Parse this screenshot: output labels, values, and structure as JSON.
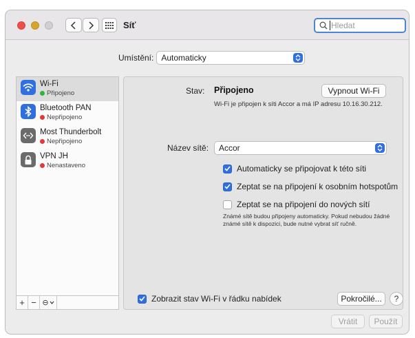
{
  "window": {
    "title": "Síť"
  },
  "search": {
    "placeholder": "Hledat"
  },
  "location": {
    "label": "Umístění:",
    "value": "Automaticky"
  },
  "services": [
    {
      "name": "Wi-Fi",
      "status": "Připojeno",
      "status_color": "#2fb53a",
      "icon": "wifi-icon"
    },
    {
      "name": "Bluetooth PAN",
      "status": "Nepřipojeno",
      "status_color": "#e03a3a",
      "icon": "bluetooth-icon"
    },
    {
      "name": "Most Thunderbolt",
      "status": "Nepřipojeno",
      "status_color": "#e03a3a",
      "icon": "thunderbolt-bridge-icon"
    },
    {
      "name": "VPN JH",
      "status": "Nenastaveno",
      "status_color": "#e03a3a",
      "icon": "vpn-lock-icon"
    }
  ],
  "sidebar_tools": {
    "add": "+",
    "remove": "−",
    "action": "⊖"
  },
  "detail": {
    "status_label": "Stav:",
    "status_value": "Připojeno",
    "turn_off_button": "Vypnout Wi-Fi",
    "info": "Wi-Fi je připojen k síti Accor a má IP adresu 10.16.30.212.",
    "network_label": "Název sítě:",
    "network_value": "Accor",
    "checkboxes": [
      {
        "label": "Automaticky se připojovat k této síti",
        "checked": true
      },
      {
        "label": "Zeptat se na připojení k osobním hotspotům",
        "checked": true
      },
      {
        "label": "Zeptat se na připojení do nových sítí",
        "checked": false
      }
    ],
    "note": "Známé sítě budou připojeny automaticky. Pokud nebudou žádné známé sítě k dispozici, bude nutné vybrat síť ručně.",
    "show_status_label": "Zobrazit stav Wi-Fi v řádku nabídek",
    "show_status_checked": true,
    "advanced_button": "Pokročilé...",
    "help": "?"
  },
  "footer": {
    "revert_button": "Vrátit",
    "apply_button": "Použít"
  },
  "colors": {
    "accent": "#2f6fde",
    "connected": "#2fb53a",
    "disconnected": "#e03a3a"
  }
}
